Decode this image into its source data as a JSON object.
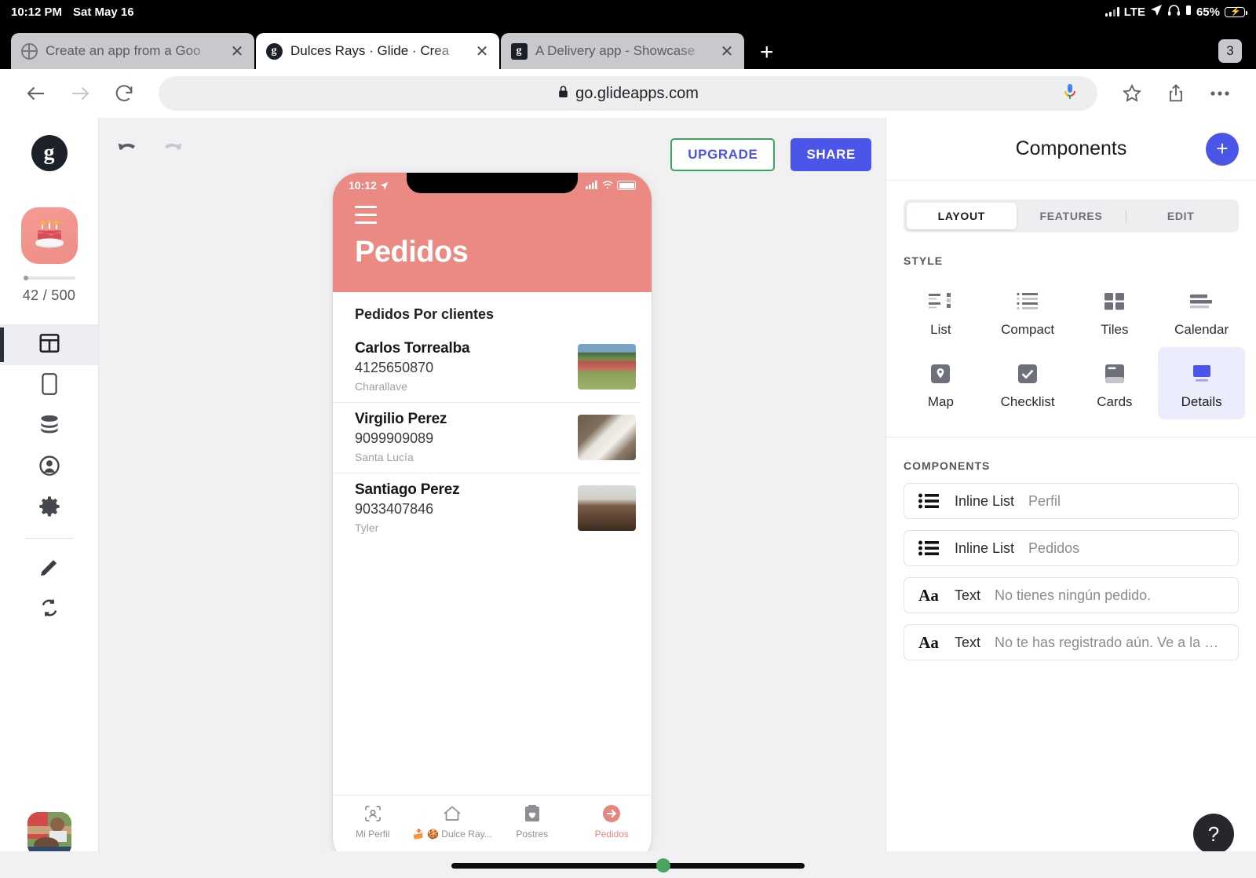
{
  "ios_status": {
    "time": "10:12 PM",
    "date": "Sat May 16",
    "network": "LTE",
    "battery": "65%",
    "icons": [
      "signal-bars",
      "location-arrow",
      "headphones",
      "battery-small"
    ]
  },
  "browser": {
    "tabs": [
      {
        "title": "Create an app from a Goo",
        "favicon": "globe-icon",
        "active": false
      },
      {
        "title": "Dulces Rays · Glide · Crea",
        "favicon": "glide-icon",
        "active": true
      },
      {
        "title": "A Delivery app - Showcase",
        "favicon": "glide-icon",
        "active": false
      }
    ],
    "new_tab_label": "+",
    "tab_count": "3",
    "url": "go.glideapps.com",
    "lock_icon": "lock-icon",
    "controls": [
      "back-arrow",
      "forward-arrow",
      "reload",
      "microphone",
      "bookmark-star",
      "share",
      "more-options"
    ]
  },
  "rail": {
    "logo": "g",
    "app_icon": "birthday-cake-icon",
    "quota": "42 / 500",
    "items": [
      {
        "name": "layout",
        "icon": "layout-icon",
        "active": true
      },
      {
        "name": "screens",
        "icon": "phone-icon",
        "active": false
      },
      {
        "name": "data",
        "icon": "database-icon",
        "active": false
      },
      {
        "name": "users",
        "icon": "user-circle-icon",
        "active": false
      },
      {
        "name": "settings",
        "icon": "gear-icon",
        "active": false
      },
      {
        "name": "design",
        "icon": "pencil-icon",
        "active": false
      },
      {
        "name": "sync",
        "icon": "refresh-icon",
        "active": false
      }
    ]
  },
  "canvas": {
    "undo": "undo-icon",
    "redo": "redo-icon",
    "upgrade_label": "UPGRADE",
    "share_label": "SHARE"
  },
  "phone": {
    "status_time": "10:12",
    "menu_icon": "hamburger-icon",
    "title": "Pedidos",
    "section_title": "Pedidos Por clientes",
    "rows": [
      {
        "name": "Carlos Torrealba",
        "phone": "4125650870",
        "place": "Charallave",
        "thumb": "crowd-field-photo"
      },
      {
        "name": "Virgilio Perez",
        "phone": "9099909089",
        "place": "Santa Lucía",
        "thumb": "white-cat-photo"
      },
      {
        "name": "Santiago Perez",
        "phone": "9033407846",
        "place": "Tyler",
        "thumb": "man-portrait-photo"
      }
    ],
    "tabs": [
      {
        "label": "Mi Perfil",
        "icon": "profile-scan-icon",
        "active": false
      },
      {
        "label": "🍰 🍪 Dulce Ray...",
        "icon": "home-icon",
        "active": false
      },
      {
        "label": "Postres",
        "icon": "bag-heart-icon",
        "active": false
      },
      {
        "label": "Pedidos",
        "icon": "arrow-in-circle-icon",
        "active": true
      }
    ]
  },
  "panel": {
    "title": "Components",
    "add_label": "+",
    "tabs": [
      {
        "label": "LAYOUT",
        "active": true
      },
      {
        "label": "FEATURES",
        "active": false
      },
      {
        "label": "EDIT",
        "active": false
      }
    ],
    "style_label": "STYLE",
    "styles": [
      {
        "label": "List",
        "icon": "list-style-icon",
        "selected": false
      },
      {
        "label": "Compact",
        "icon": "compact-style-icon",
        "selected": false
      },
      {
        "label": "Tiles",
        "icon": "tiles-style-icon",
        "selected": false
      },
      {
        "label": "Calendar",
        "icon": "calendar-style-icon",
        "selected": false
      },
      {
        "label": "Map",
        "icon": "map-pin-icon",
        "selected": false
      },
      {
        "label": "Checklist",
        "icon": "checklist-icon",
        "selected": false
      },
      {
        "label": "Cards",
        "icon": "cards-icon",
        "selected": false
      },
      {
        "label": "Details",
        "icon": "details-icon",
        "selected": true
      }
    ],
    "components_label": "COMPONENTS",
    "components": [
      {
        "icon": "inline-list-icon",
        "kind": "Inline List",
        "value": "Perfil"
      },
      {
        "icon": "inline-list-icon",
        "kind": "Inline List",
        "value": "Pedidos"
      },
      {
        "icon": "text-icon",
        "kind": "Text",
        "value": "No tienes ningún pedido."
      },
      {
        "icon": "text-icon",
        "kind": "Text",
        "value": "No te has registrado aún.  Ve a la pesta…"
      }
    ],
    "help_label": "?"
  },
  "colors": {
    "accent_blue": "#4b55e8",
    "upgrade_border_green": "#3ba55d",
    "app_pink": "#ea8a82",
    "selected_style_bg": "#ecedfc"
  }
}
